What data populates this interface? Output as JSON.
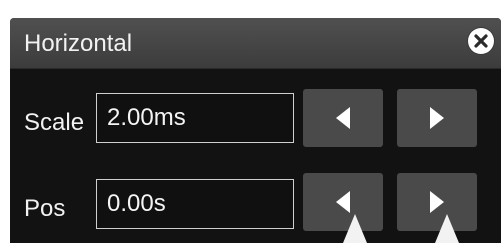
{
  "dialog": {
    "title": "Horizontal"
  },
  "scale": {
    "label": "Scale",
    "value": "2.00ms"
  },
  "position": {
    "label": "Pos",
    "value": "0.00s"
  },
  "icons": {
    "close": "close-icon",
    "left": "triangle-left-icon",
    "right": "triangle-right-icon",
    "pointer": "pointer-arrow-icon"
  },
  "colors": {
    "panel": "#121212",
    "titlebar": "#464646",
    "button": "#4a4a4a",
    "text": "#f2f2f2"
  }
}
